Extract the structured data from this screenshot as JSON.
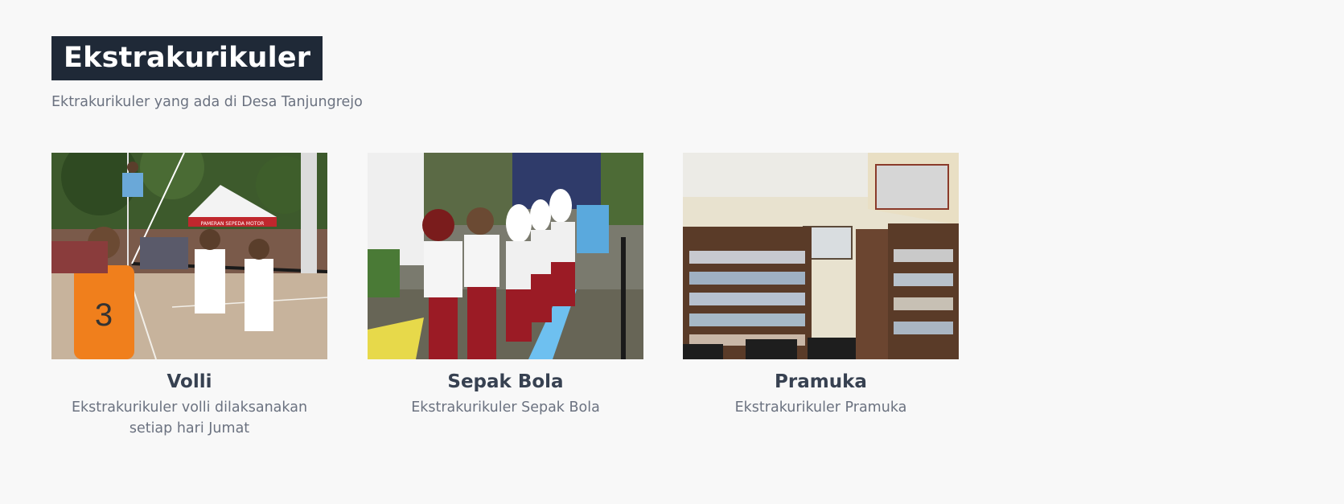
{
  "section": {
    "title": "Ekstrakurikuler",
    "subtitle": "Ektrakurikuler yang ada di Desa Tanjungrejo"
  },
  "cards": [
    {
      "title": "Volli",
      "description": "Ekstrakurikuler volli dilaksanakan setiap hari Jumat",
      "photo_jersey_number": "3",
      "photo_tent_text": "PAMERAN SEPEDA MOTOR"
    },
    {
      "title": "Sepak Bola",
      "description": "Ekstrakurikuler Sepak Bola"
    },
    {
      "title": "Pramuka",
      "description": "Ekstrakurikuler Pramuka"
    }
  ],
  "colors": {
    "background": "#f8f8f8",
    "title_bg": "#1f2937",
    "title_text": "#ffffff",
    "heading": "#374151",
    "body_text": "#6b7280"
  }
}
